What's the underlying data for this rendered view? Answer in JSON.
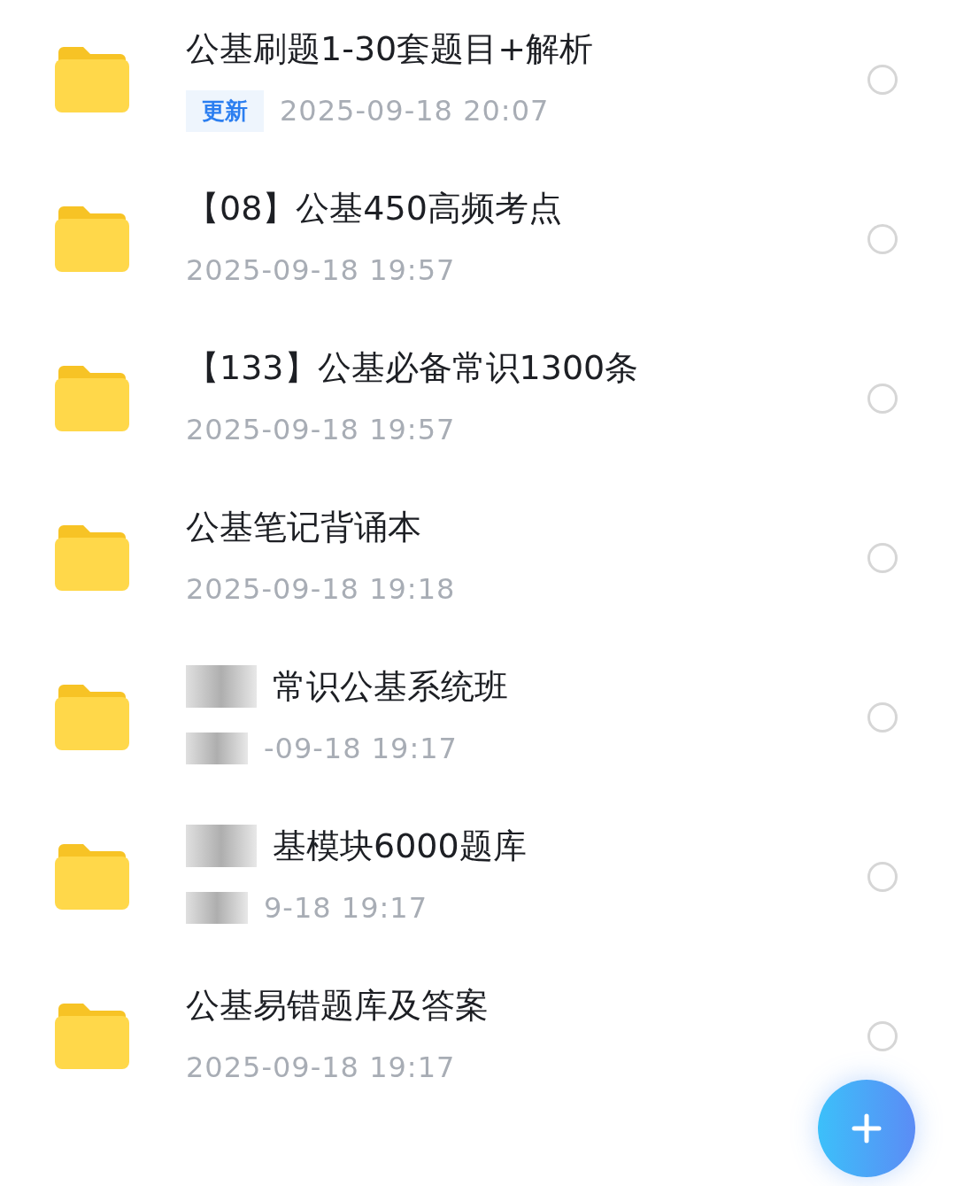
{
  "files": [
    {
      "name": "公基刷题1-30套题目+解析",
      "badge": "更新",
      "date": "2025-09-18  20:07",
      "blurred": false,
      "selected": false
    },
    {
      "name": "【08】公基450高频考点",
      "date": "2025-09-18  19:57",
      "blurred": false,
      "selected": false
    },
    {
      "name": "【133】公基必备常识1300条",
      "date": "2025-09-18  19:57",
      "blurred": false,
      "selected": false
    },
    {
      "name": "公基笔记背诵本",
      "date": "2025-09-18  19:18",
      "blurred": false,
      "selected": false
    },
    {
      "name": "常识公基系统班",
      "date": "-09-18  19:17",
      "blurred": true,
      "selected": false
    },
    {
      "name": "基模块6000题库",
      "date": "9-18  19:17",
      "blurred": true,
      "selected": false
    },
    {
      "name": "公基易错题库及答案",
      "date": "2025-09-18  19:17",
      "blurred": false,
      "selected": false
    }
  ]
}
